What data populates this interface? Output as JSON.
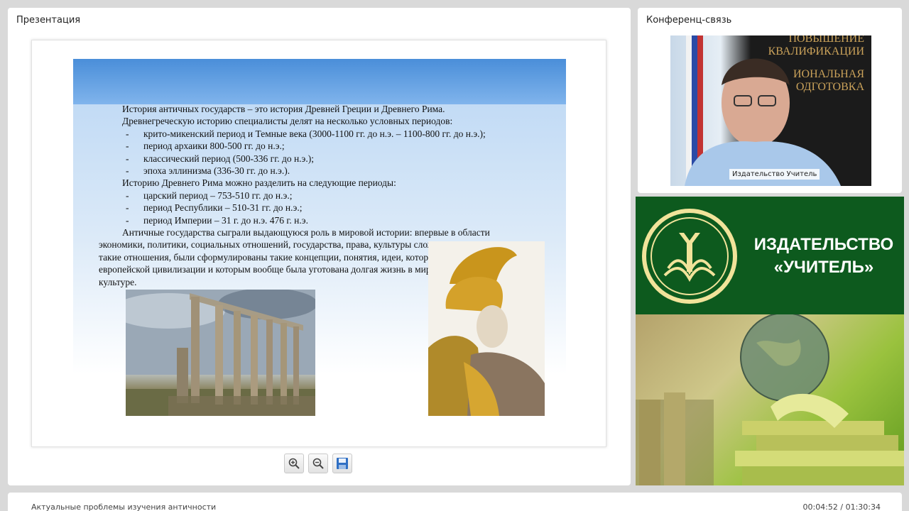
{
  "presentation": {
    "panel_title": "Презентация",
    "slide": {
      "lines": [
        {
          "text": "История античных государств – это история Древней Греции и Древнего Рима.",
          "style": "indent"
        },
        {
          "text": "Древнегреческую историю специалисты делят на несколько условных периодов:",
          "style": "indent"
        },
        {
          "text": "крито-микенский период и Темные века (3000-1100 гг. до н.э. – 1100-800 гг. до н.э.);",
          "style": "bullet"
        },
        {
          "text": "период архаики 800-500 гг. до н.э.;",
          "style": "bullet"
        },
        {
          "text": "классический период (500-336 гг. до н.э.);",
          "style": "bullet"
        },
        {
          "text": "эпоха эллинизма (336-30 гг. до н.э.).",
          "style": "bullet"
        },
        {
          "text": "Историю Древнего Рима можно разделить на следующие периоды:",
          "style": "indent"
        },
        {
          "text": "царский период – 753-510 гг. до н.э.;",
          "style": "bullet"
        },
        {
          "text": "период Республики – 510-31 гг. до н.э.;",
          "style": "bullet"
        },
        {
          "text": "период Империи – 31 г. до н.э. 476 г. н.э.",
          "style": "bullet"
        }
      ],
      "paragraph": "Античные государства сыграли выдающуюся роль в мировой истории: впервые в области экономики, политики, социальных отношений, государства, права, культуры сложились и развились такие отношения, были сформулированы такие концепции, понятия, идеи, которые составили основу европейской цивилизации и которым вообще была уготована долгая жизнь в мировой истории и культуре.",
      "bullet_char": "-"
    },
    "toolbar": {
      "zoom_in_icon": "zoom-in-icon",
      "zoom_out_icon": "zoom-out-icon",
      "save_icon": "save-icon"
    }
  },
  "conference": {
    "panel_title": "Конференц-связь",
    "speaker_label": "Издательство Учитель",
    "backdrop_lines": [
      "ПОВЫШЕНИЕ",
      "КВАЛИФИКАЦИИ",
      "ИОНАЛЬНАЯ",
      "ОДГОТОВКА"
    ]
  },
  "publisher": {
    "name_line1": "ИЗДАТЕЛЬСТВО",
    "name_line2": "«УЧИТЕЛЬ»",
    "colors": {
      "green": "#0d5a1e",
      "logo_gold": "#f1e39a"
    }
  },
  "status": {
    "course_title": "Актуальные проблемы изучения античности",
    "time": "00:04:52 / 01:30:34"
  }
}
